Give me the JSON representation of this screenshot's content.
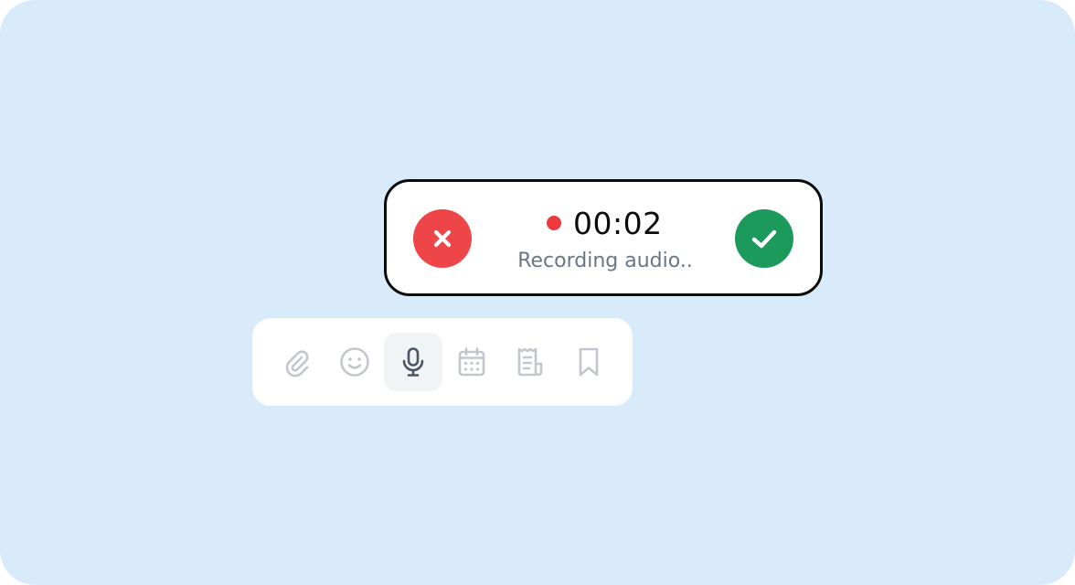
{
  "recorder": {
    "timer": "00:02",
    "status": "Recording audio..",
    "cancel_icon": "close-icon",
    "confirm_icon": "check-icon",
    "colors": {
      "cancel": "#ee4548",
      "confirm": "#1b9a5c",
      "recording_dot": "#ee3a3e",
      "border": "#0b0b0b"
    }
  },
  "toolbar": {
    "items": [
      {
        "icon": "paperclip-icon",
        "active": false
      },
      {
        "icon": "smiley-icon",
        "active": false
      },
      {
        "icon": "microphone-icon",
        "active": true
      },
      {
        "icon": "calendar-icon",
        "active": false
      },
      {
        "icon": "receipt-icon",
        "active": false
      },
      {
        "icon": "bookmark-icon",
        "active": false
      }
    ],
    "colors": {
      "inactive_icon": "#c3c7cd",
      "active_icon": "#4b5563",
      "active_bg": "#f1f3f5"
    }
  },
  "background": "#d9eafb"
}
